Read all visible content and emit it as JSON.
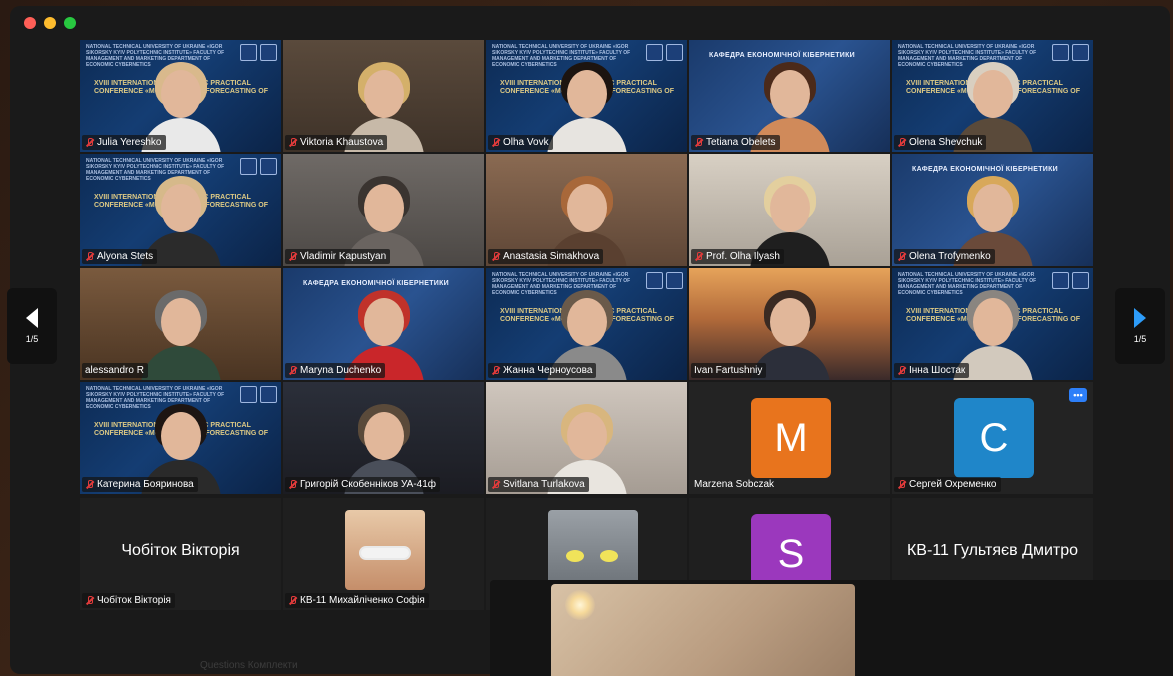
{
  "window": {
    "pagination": {
      "current_left": "1/5",
      "current_right": "1/5"
    }
  },
  "grid_tiles": [
    {
      "name": "Julia Yereshko",
      "muted": true,
      "bg": "conf",
      "hair": "#d9b98c",
      "shirt": "#e9e9e9"
    },
    {
      "name": "Viktoria Khaustova",
      "muted": true,
      "bg": "room1",
      "hair": "#d4b06a",
      "shirt": "#c7b9a8"
    },
    {
      "name": "Olha Vovk",
      "muted": true,
      "bg": "conf",
      "hair": "#1c1410",
      "shirt": "#e7e4e0"
    },
    {
      "name": "Tetiana Obelets",
      "muted": true,
      "bg": "kaf",
      "hair": "#4b2a1a",
      "shirt": "#d08a5a"
    },
    {
      "name": "Olena Shevchuk",
      "muted": true,
      "bg": "conf",
      "hair": "#d9cfc0",
      "shirt": "#5a4a3a"
    },
    {
      "name": "Alyona Stets",
      "muted": true,
      "bg": "conf",
      "hair": "#d6b98a",
      "shirt": "#2b2b2b"
    },
    {
      "name": "Vladimir Kapustyan",
      "muted": true,
      "bg": "room2",
      "hair": "#3a3430",
      "shirt": "#6a6460"
    },
    {
      "name": "Anastasia Simakhova",
      "muted": true,
      "bg": "room3",
      "hair": "#a8683a",
      "shirt": "#5a4030"
    },
    {
      "name": "Prof. Olha Ilyash",
      "muted": true,
      "bg": "room4",
      "hair": "#e3cf9e",
      "shirt": "#1f1f1f"
    },
    {
      "name": "Olena Trofymenko",
      "muted": true,
      "bg": "kaf",
      "hair": "#d8a85a",
      "shirt": "#6a4a3a"
    },
    {
      "name": "alessandro R",
      "muted": false,
      "bg": "room5",
      "hair": "#6a6a6a",
      "shirt": "#2f4a3a",
      "active": true
    },
    {
      "name": "Maryna Duchenko",
      "muted": true,
      "bg": "kaf",
      "hair": "#c0322a",
      "shirt": "#c9262a"
    },
    {
      "name": "Жанна Черноусова",
      "muted": true,
      "bg": "conf",
      "hair": "#6a5a4a",
      "shirt": "#8a8a8a"
    },
    {
      "name": "Ivan Fartushniy",
      "muted": false,
      "bg": "sunset",
      "hair": "#3a2a22",
      "shirt": "#2c2f3a"
    },
    {
      "name": "Інна Шостак",
      "muted": true,
      "bg": "conf",
      "hair": "#8a8580",
      "shirt": "#d2c9bd"
    },
    {
      "name": "Катерина Бояринова",
      "muted": true,
      "bg": "conf",
      "hair": "#1d1512",
      "shirt": "#2a2a2a"
    },
    {
      "name": "Григорій Скобенніков УА-41ф",
      "muted": true,
      "bg": "dark",
      "hair": "#5a4a3a",
      "shirt": "#4a4f5a"
    },
    {
      "name": "Svitlana Turlakova",
      "muted": true,
      "bg": "light",
      "hair": "#d8b67e",
      "shirt": "#e9e5df"
    },
    {
      "name": "Marzena Sobczak",
      "muted": false,
      "avatar": "M",
      "avatar_color": "#e8741d"
    },
    {
      "name": "Сергей Охременко",
      "muted": true,
      "avatar": "C",
      "avatar_color": "#1f86c9",
      "more": "•••"
    }
  ],
  "strip_tiles": [
    {
      "name": "Чобіток Вікторія",
      "muted": true,
      "big_name": "Чобіток Вікторія"
    },
    {
      "name": "КВ-11 Михайліченко Софія",
      "muted": true,
      "photo": "child"
    },
    {
      "name": "",
      "muted": false,
      "photo": "cartoon"
    },
    {
      "name": "",
      "muted": false,
      "avatar": "S",
      "avatar_color": "#9b38bd"
    },
    {
      "name": "",
      "muted": false,
      "big_name": "КВ-11 Гультяєв Дмитро"
    }
  ],
  "conference": {
    "header_text": "NATIONAL TECHNICAL UNIVERSITY OF UKRAINE «IGOR SIKORSKY KYIV POLYTECHNIC INSTITUTE» FACULTY OF MANAGEMENT AND MARKETING DEPARTMENT OF ECONOMIC CYBERNETICS",
    "banner_text": "XVIII INTERNATIONAL SCIENTIFIC PRACTICAL CONFERENCE «MODELING AND FORECASTING OF",
    "kaf_text": "КАФЕДРА ЕКОНОМІЧНОЇ КІБЕРНЕТИКИ"
  },
  "bottom_text": "Questions  Комплекти"
}
